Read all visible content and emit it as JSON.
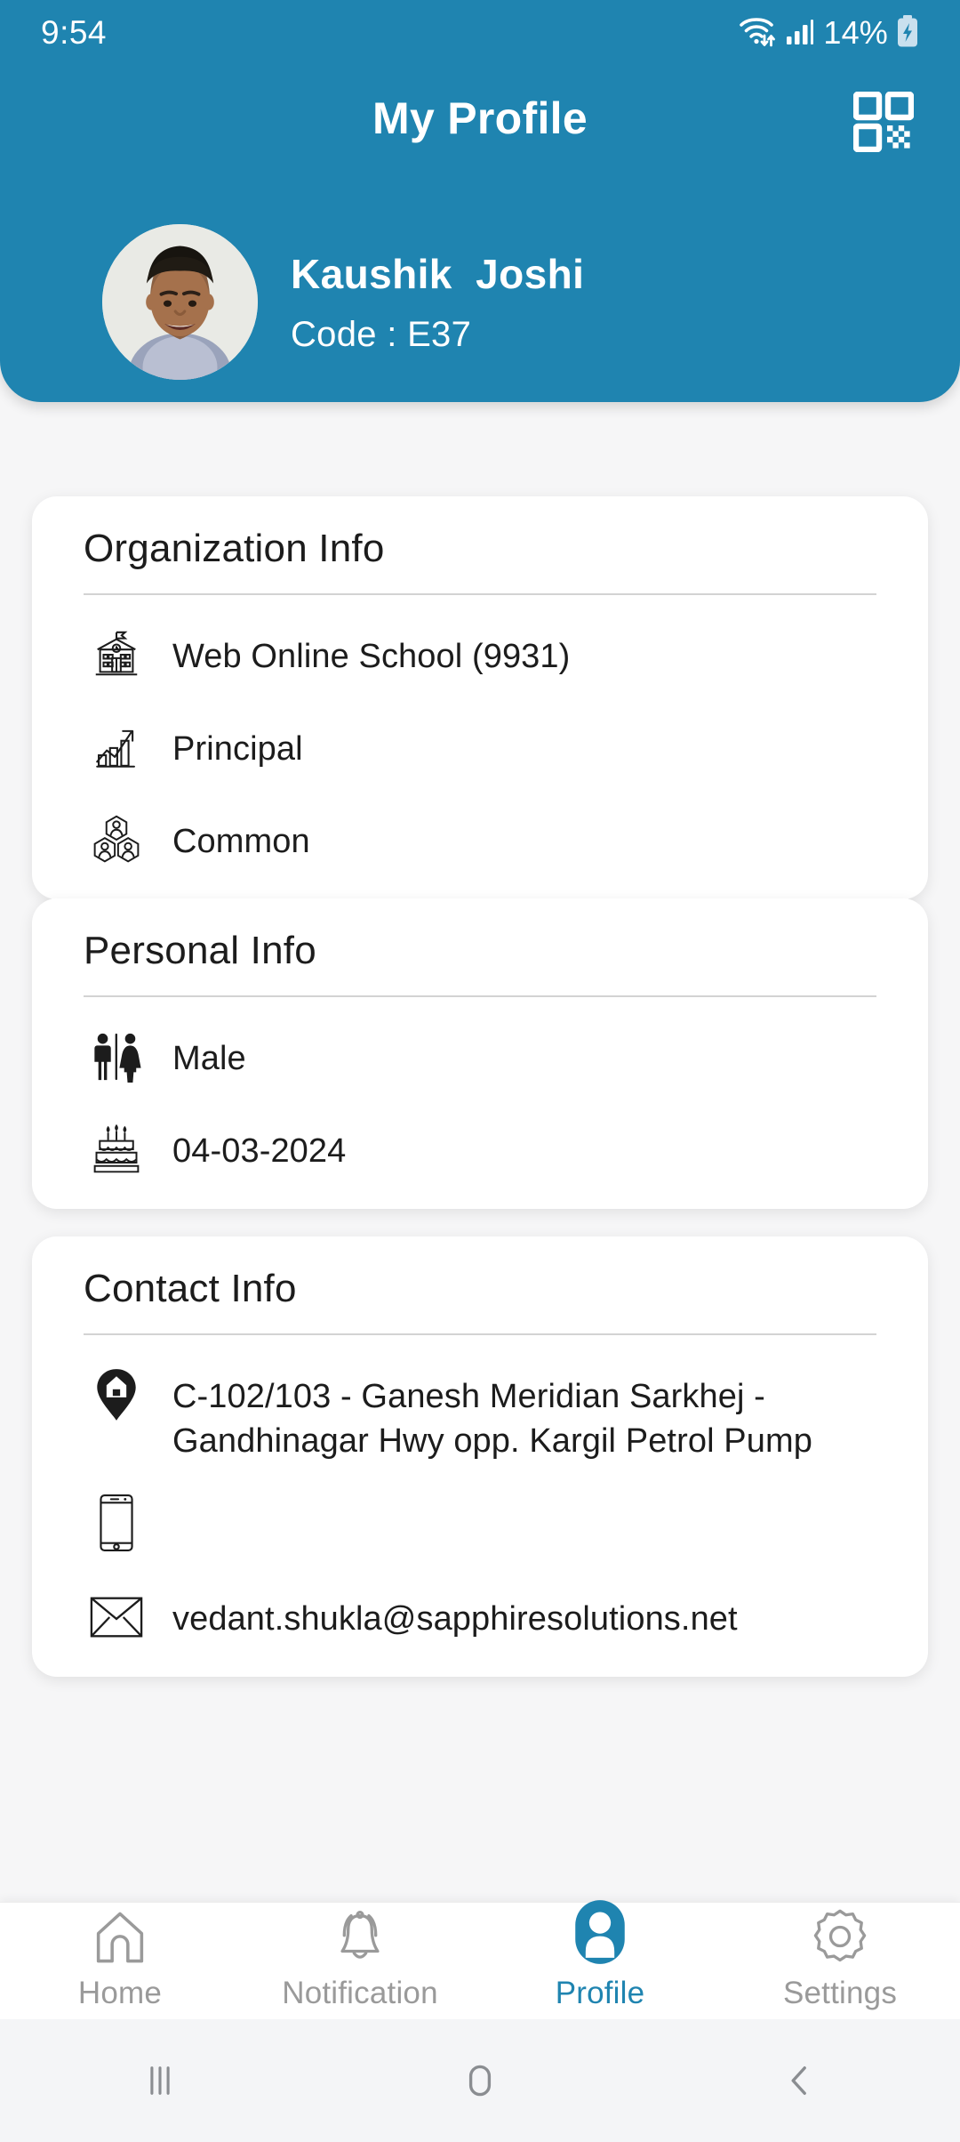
{
  "status_bar": {
    "time": "9:54",
    "battery_percent": "14%",
    "icons": [
      "wifi-icon",
      "cellular-signal-icon",
      "battery-charging-icon"
    ]
  },
  "header": {
    "title": "My Profile",
    "qr_icon": "qr-code-icon",
    "accent_color": "#1f84b0",
    "profile": {
      "name": "Kaushik  Joshi",
      "code": "Code : E37",
      "avatar": "user-photo-avatar"
    }
  },
  "cards": {
    "organization": {
      "title": "Organization Info",
      "rows": [
        {
          "icon": "school-building-icon",
          "value": "Web Online School (9931)"
        },
        {
          "icon": "growth-chart-icon",
          "value": "Principal"
        },
        {
          "icon": "user-group-icon",
          "value": "Common"
        }
      ]
    },
    "personal": {
      "title": "Personal Info",
      "rows": [
        {
          "icon": "gender-icon",
          "value": "Male"
        },
        {
          "icon": "birthday-cake-icon",
          "value": "04-03-2024"
        }
      ]
    },
    "contact": {
      "title": "Contact Info",
      "rows": [
        {
          "icon": "home-location-pin-icon",
          "value": "C-102/103 - Ganesh Meridian Sarkhej - Gandhinagar Hwy opp. Kargil Petrol Pump"
        },
        {
          "icon": "mobile-phone-icon",
          "value": ""
        },
        {
          "icon": "envelope-icon",
          "value": "vedant.shukla@sapphiresolutions.net"
        }
      ]
    }
  },
  "bottom_nav": {
    "active": "Profile",
    "items": [
      {
        "label": "Home",
        "icon": "home-icon"
      },
      {
        "label": "Notification",
        "icon": "bell-icon"
      },
      {
        "label": "Profile",
        "icon": "person-icon"
      },
      {
        "label": "Settings",
        "icon": "gear-icon"
      }
    ],
    "inactive_color": "#9a9a9a",
    "active_color": "#1f84b0"
  },
  "system_nav": {
    "buttons": [
      "recents-icon",
      "home-circle-icon",
      "back-chevron-icon"
    ]
  }
}
